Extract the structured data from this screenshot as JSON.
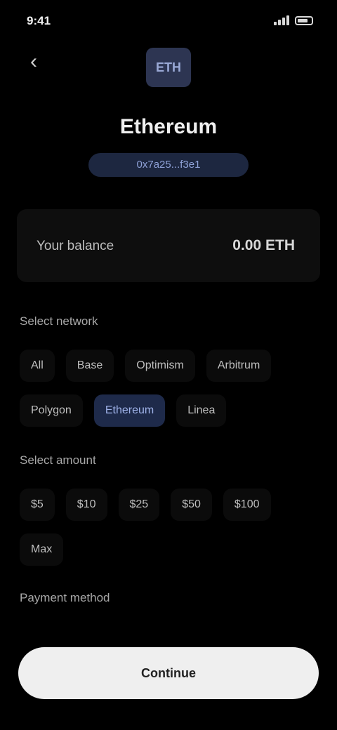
{
  "status_bar": {
    "time": "9:41"
  },
  "header": {
    "back_icon": "chevron-left-icon",
    "token_symbol": "ETH",
    "token_name": "Ethereum",
    "token_address": "0x7a25...f3e1"
  },
  "balance": {
    "label": "Your balance",
    "value": "0.00 ETH"
  },
  "sections": [
    {
      "title": "Select network",
      "chips": [
        {
          "label": "All",
          "active": false
        },
        {
          "label": "Base",
          "active": false
        },
        {
          "label": "Optimism",
          "active": false
        },
        {
          "label": "Arbitrum",
          "active": false
        },
        {
          "label": "Polygon",
          "active": false
        },
        {
          "label": "Ethereum",
          "active": true
        },
        {
          "label": "Linea",
          "active": false
        }
      ]
    },
    {
      "title": "Select amount",
      "chips": [
        {
          "label": "$5",
          "active": false
        },
        {
          "label": "$10",
          "active": false
        },
        {
          "label": "$25",
          "active": false
        },
        {
          "label": "$50",
          "active": false
        },
        {
          "label": "$100",
          "active": false
        },
        {
          "label": "Max",
          "active": false
        }
      ]
    },
    {
      "title": "Payment method",
      "chips": []
    }
  ],
  "primary_action": {
    "label": "Continue"
  },
  "colors": {
    "background": "#000000",
    "accent": "#9fb2e8",
    "button": "#efefef"
  }
}
